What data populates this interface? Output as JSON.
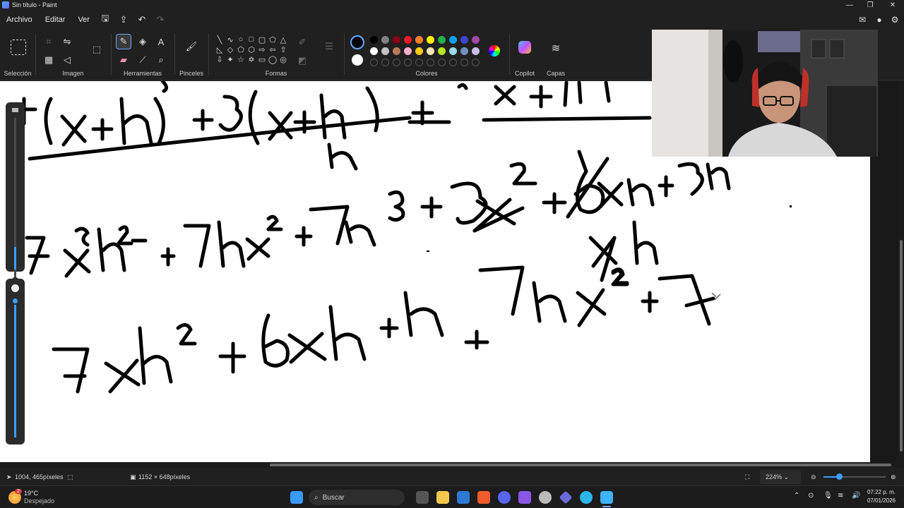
{
  "window": {
    "title": "Sin título - Paint"
  },
  "menu": {
    "file": "Archivo",
    "edit": "Editar",
    "view": "Ver"
  },
  "ribbon": {
    "groups": {
      "selection": "Selección",
      "image": "Imagen",
      "tools": "Herramientas",
      "brushes": "Pinceles",
      "shapes": "Formas",
      "colors": "Colores",
      "copilot": "Copilot",
      "layers": "Capas"
    },
    "palette_row1": [
      "#000000",
      "#7f7f7f",
      "#880015",
      "#ed1c24",
      "#ff7f27",
      "#fff200",
      "#22b14c",
      "#00a2e8",
      "#3f48cc",
      "#a349a4"
    ],
    "palette_row2": [
      "#ffffff",
      "#c3c3c3",
      "#b97a57",
      "#ffaec9",
      "#ffc90e",
      "#efe4b0",
      "#b5e61d",
      "#99d9ea",
      "#7092be",
      "#c8bfe7"
    ],
    "primary_color": "#000000",
    "secondary_color": "#ffffff"
  },
  "status": {
    "cursor_position": "1004, 465píxeles",
    "canvas_size": "1152 × 648píxeles",
    "zoom": "224%"
  },
  "taskbar": {
    "weather_temp": "19°C",
    "weather_desc": "Despejado",
    "search_placeholder": "Buscar",
    "clock_time": "07:22 p. m.",
    "clock_date": "07/01/2026",
    "notif_badge": "2"
  }
}
